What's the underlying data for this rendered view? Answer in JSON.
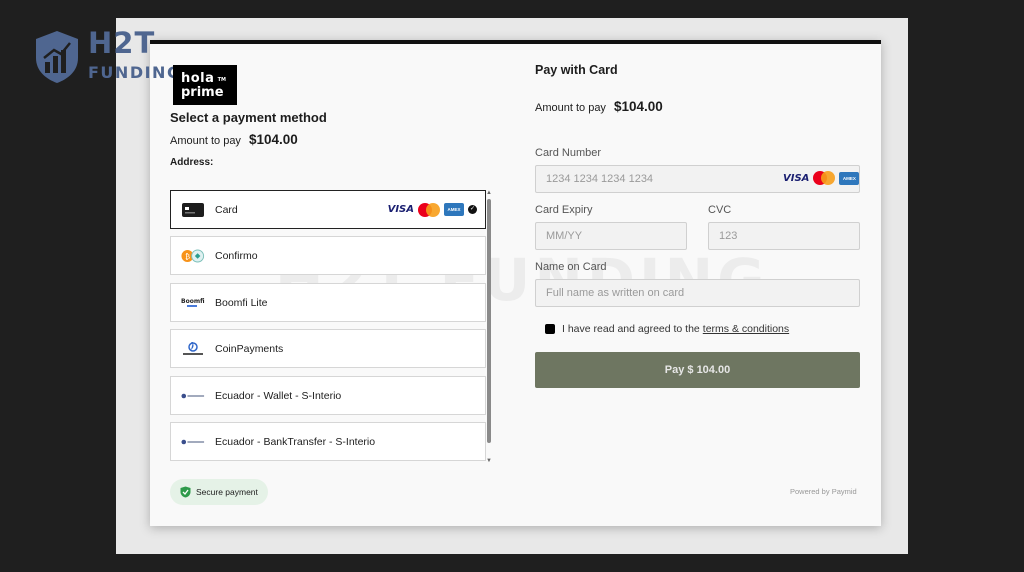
{
  "brand": {
    "title": "H2T",
    "subtitle": "FUNDING",
    "color": "#4f6690"
  },
  "merchant": {
    "logo_line1": "hola",
    "logo_line2": "prime",
    "logo_tm": "TM"
  },
  "left": {
    "title": "Select a payment method",
    "amount_label": "Amount to pay",
    "amount_value": "$104.00",
    "address_label": "Address:"
  },
  "methods": [
    {
      "label": "Card",
      "icon": "card-icon",
      "selected": true
    },
    {
      "label": "Confirmo",
      "icon": "crypto-icon",
      "selected": false
    },
    {
      "label": "Boomfi Lite",
      "icon": "boomfi-icon",
      "selected": false
    },
    {
      "label": "CoinPayments",
      "icon": "coinpayments-icon",
      "selected": false
    },
    {
      "label": "Ecuador - Wallet - S-Interio",
      "icon": "ecuador-icon",
      "selected": false
    },
    {
      "label": "Ecuador - BankTransfer - S-Interio",
      "icon": "ecuador-icon",
      "selected": false
    }
  ],
  "card_brands": {
    "visa": "VISA",
    "amex": "AMEX"
  },
  "secure_label": "Secure payment",
  "right": {
    "title": "Pay with Card",
    "amount_label": "Amount to pay",
    "amount_value": "$104.00",
    "card_number_label": "Card Number",
    "card_number_placeholder": "1234 1234 1234 1234",
    "expiry_label": "Card Expiry",
    "expiry_placeholder": "MM/YY",
    "cvc_label": "CVC",
    "cvc_placeholder": "123",
    "name_label": "Name on Card",
    "name_placeholder": "Full name as written on card",
    "agree_prefix": "I have read and agreed to the",
    "terms_link": "terms & conditions",
    "pay_button": "Pay $ 104.00"
  },
  "powered_by": "Powered by Paymid",
  "watermark": "H2T FUNDING",
  "colors": {
    "pay_button": "#6e7661",
    "secure_bg": "#e5f2e7",
    "secure_icon": "#2e9a4a"
  }
}
